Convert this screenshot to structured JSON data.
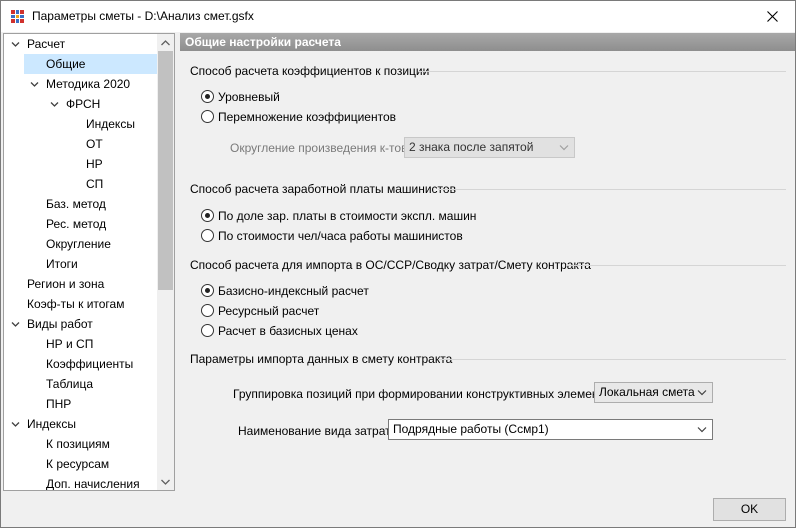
{
  "window": {
    "title": "Параметры сметы - D:\\Анализ смет.gsfx"
  },
  "tree": {
    "items": [
      {
        "label": "Расчет",
        "expanded": true
      },
      {
        "label": "Общие",
        "selected": true
      },
      {
        "label": "Методика 2020",
        "expanded": true
      },
      {
        "label": "ФРСН",
        "expanded": true
      },
      {
        "label": "Индексы"
      },
      {
        "label": "ОТ"
      },
      {
        "label": "НР"
      },
      {
        "label": "СП"
      },
      {
        "label": "Баз. метод"
      },
      {
        "label": "Рес. метод"
      },
      {
        "label": "Округление"
      },
      {
        "label": "Итоги"
      },
      {
        "label": "Регион и зона"
      },
      {
        "label": "Коэф-ты к итогам"
      },
      {
        "label": "Виды работ",
        "expanded": true
      },
      {
        "label": "НР и СП"
      },
      {
        "label": "Коэффициенты"
      },
      {
        "label": "Таблица"
      },
      {
        "label": "ПНР"
      },
      {
        "label": "Индексы",
        "expanded": true
      },
      {
        "label": "К позициям"
      },
      {
        "label": "К ресурсам"
      },
      {
        "label": "Доп. начисления"
      }
    ]
  },
  "panel": {
    "header": "Общие настройки расчета",
    "group1": {
      "title": "Способ расчета коэффициентов к позиции",
      "options": [
        "Уровневый",
        "Перемножение коэффициентов"
      ],
      "selected_index": 0,
      "rounding_label": "Округление произведения к-тов:",
      "rounding_value": "2 знака после запятой"
    },
    "group2": {
      "title": "Способ расчета заработной платы машинистов",
      "options": [
        "По доле зар. платы в стоимости экспл. машин",
        "По стоимости чел/часа работы машинистов"
      ],
      "selected_index": 0
    },
    "group3": {
      "title": "Способ расчета для импорта в ОС/ССР/Сводку затрат/Смету контракта",
      "options": [
        "Базисно-индексный расчет",
        "Ресурсный расчет",
        "Расчет в базисных ценах"
      ],
      "selected_index": 0
    },
    "group4": {
      "title": "Параметры импорта данных в смету контракта",
      "grouping_label": "Группировка позиций при формировании конструктивных элементов:",
      "grouping_value": "Локальная смета",
      "cost_type_label": "Наименование вида затрат:",
      "cost_type_value": "Подрядные работы (Ссмр1)"
    }
  },
  "buttons": {
    "ok": "OK"
  }
}
